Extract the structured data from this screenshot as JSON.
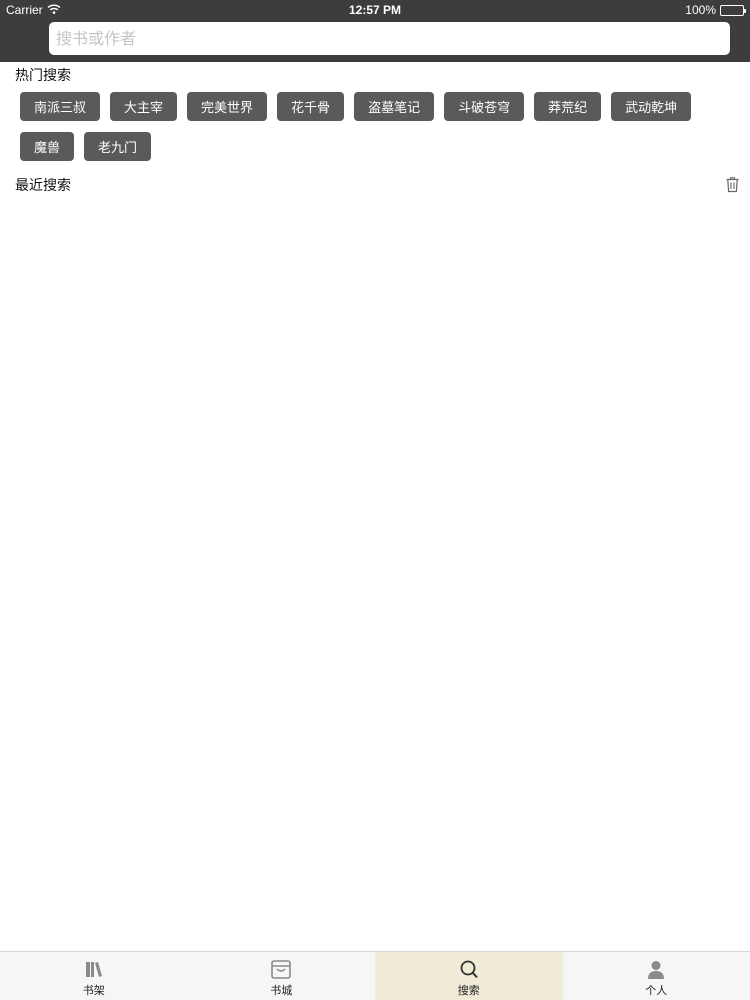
{
  "status_bar": {
    "carrier": "Carrier",
    "time": "12:57 PM",
    "battery": "100%",
    "battery_level": 1.0
  },
  "search": {
    "placeholder": "搜书或作者",
    "value": ""
  },
  "hot_search": {
    "title": "热门搜索",
    "tags": [
      "南派三叔",
      "大主宰",
      "完美世界",
      "花千骨",
      "盗墓笔记",
      "斗破苍穹",
      "莽荒纪",
      "武动乾坤",
      "魔兽",
      "老九门"
    ]
  },
  "recent_search": {
    "title": "最近搜索",
    "icon": "trash-icon",
    "items": []
  },
  "tabbar": {
    "active_index": 2,
    "active_color": "#efebd6",
    "tabs": [
      {
        "label": "书架",
        "icon": "bookshelf-icon"
      },
      {
        "label": "书城",
        "icon": "bookstore-icon"
      },
      {
        "label": "搜索",
        "icon": "search-icon"
      },
      {
        "label": "个人",
        "icon": "person-icon"
      }
    ]
  },
  "colors": {
    "header_bg": "#3d3d3d",
    "tag_bg": "#5a5a5a",
    "tabbar_bg": "#f6f6f6"
  }
}
